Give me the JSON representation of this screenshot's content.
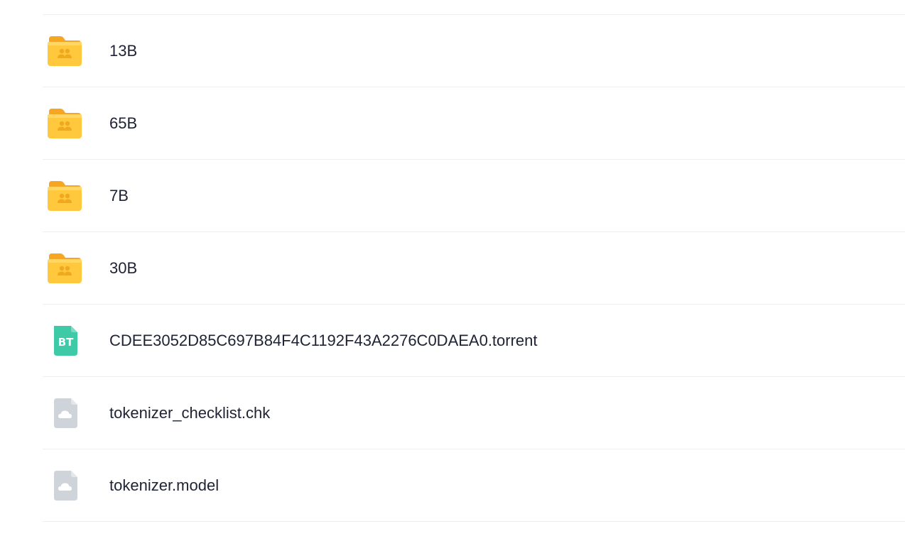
{
  "files": [
    {
      "name": "13B",
      "type": "shared-folder",
      "icon": "shared-folder-icon"
    },
    {
      "name": "65B",
      "type": "shared-folder",
      "icon": "shared-folder-icon"
    },
    {
      "name": "7B",
      "type": "shared-folder",
      "icon": "shared-folder-icon"
    },
    {
      "name": "30B",
      "type": "shared-folder",
      "icon": "shared-folder-icon"
    },
    {
      "name": "CDEE3052D85C697B84F4C1192F43A2276C0DAEA0.torrent",
      "type": "torrent",
      "icon": "bt-torrent-icon",
      "icon_text": "BT"
    },
    {
      "name": "tokenizer_checklist.chk",
      "type": "unknown-file",
      "icon": "cloud-file-icon"
    },
    {
      "name": "tokenizer.model",
      "type": "unknown-file",
      "icon": "cloud-file-icon"
    }
  ],
  "colors": {
    "folder_body": "#ffc83d",
    "folder_tab": "#f5a623",
    "torrent_icon": "#3ec9a7",
    "generic_file": "#cfd3da",
    "divider": "#eceef2",
    "text": "#1f2233"
  }
}
